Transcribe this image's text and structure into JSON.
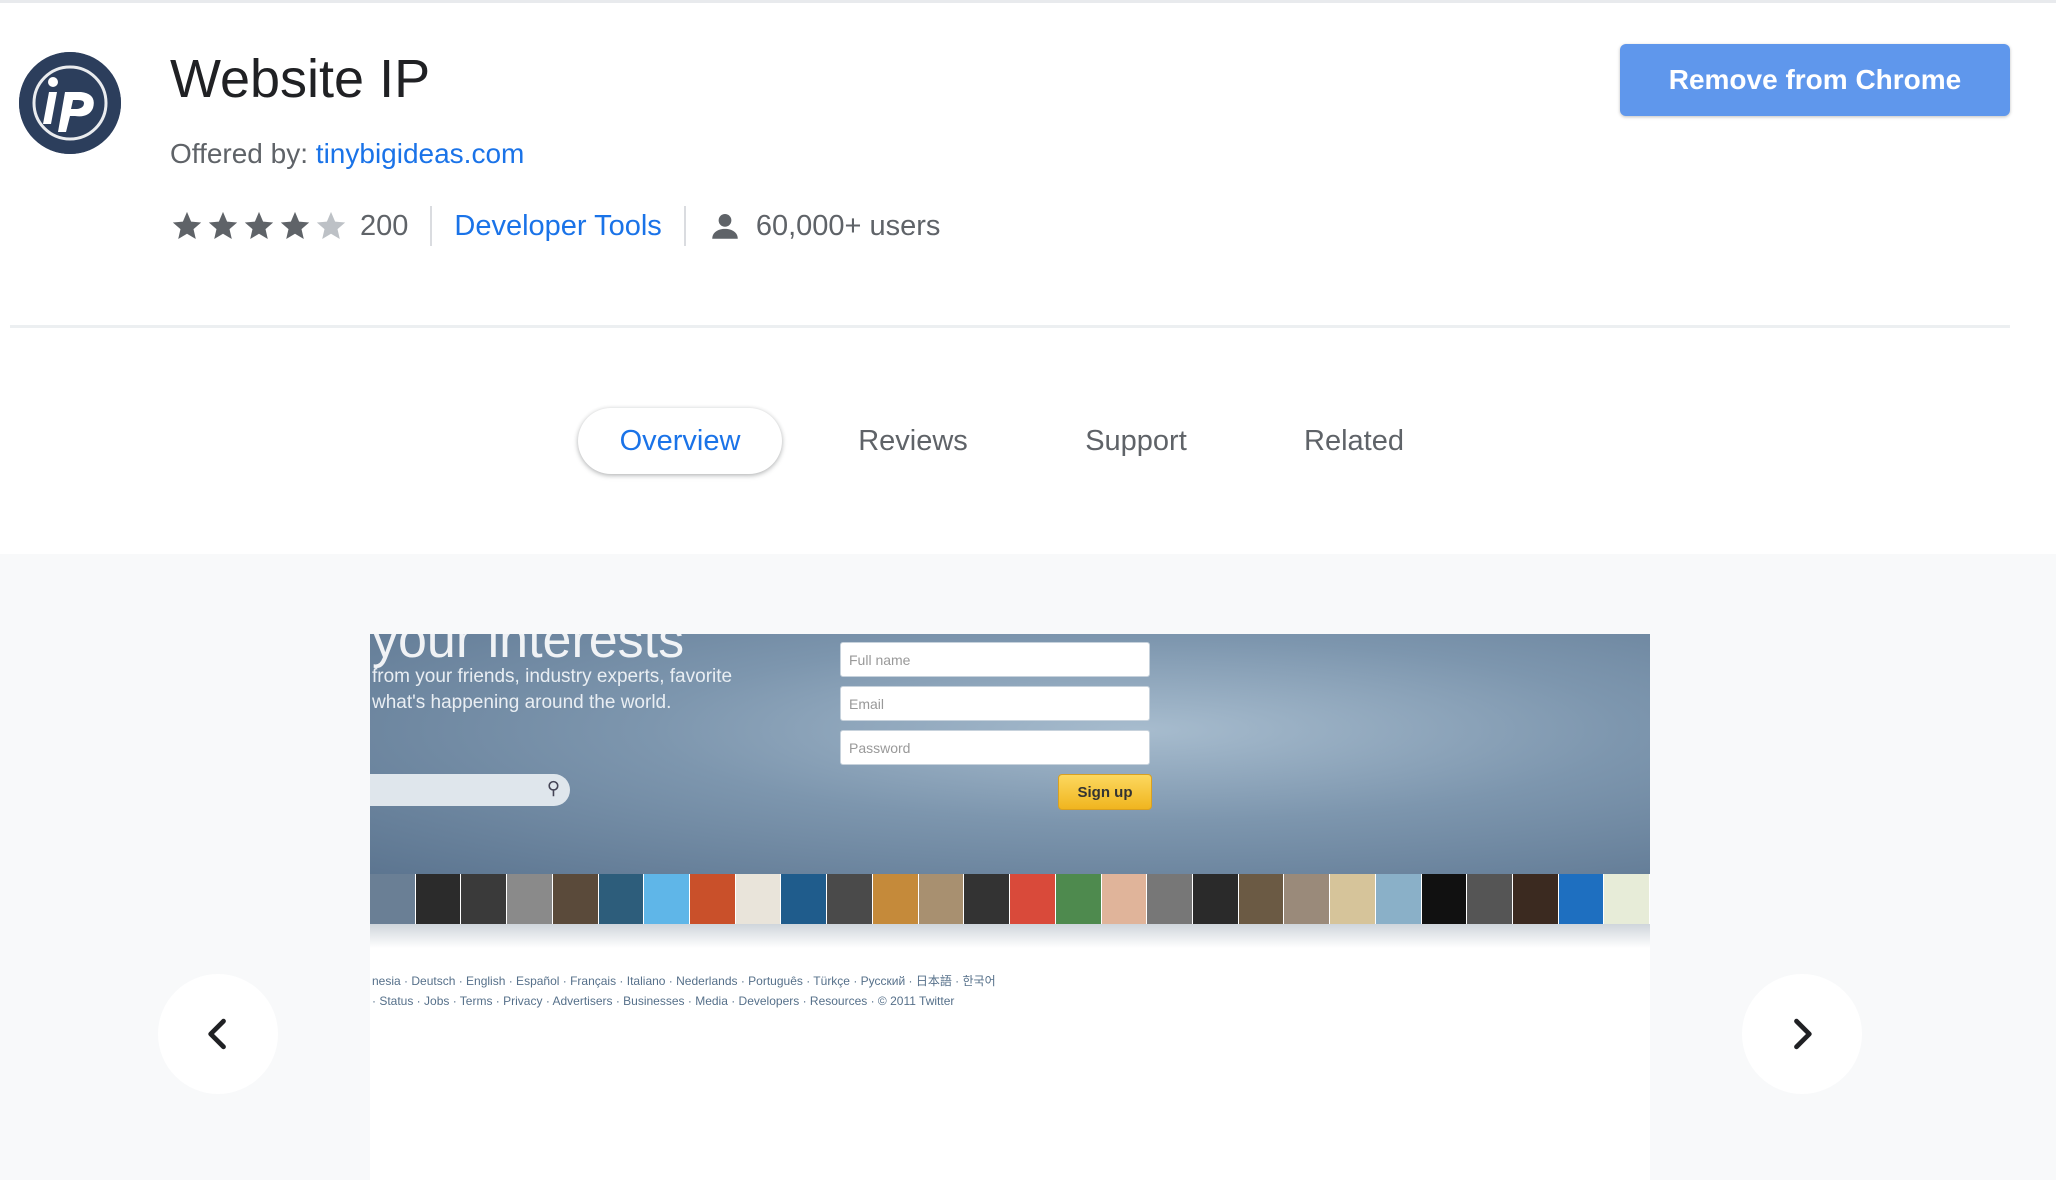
{
  "extension": {
    "name": "Website IP",
    "offered_by_label": "Offered by:",
    "offered_by_link": "tinybigideas.com",
    "rating_stars": 4,
    "rating_max": 5,
    "rating_count": "200",
    "category": "Developer Tools",
    "users": "60,000+ users",
    "logo_icon": "ip-logo-icon"
  },
  "actions": {
    "remove_label": "Remove from Chrome"
  },
  "colors": {
    "accent": "#1a73e8",
    "button": "#5f97ec",
    "logo": "#2c3e5c"
  },
  "tabs": [
    {
      "label": "Overview",
      "active": true
    },
    {
      "label": "Reviews",
      "active": false
    },
    {
      "label": "Support",
      "active": false
    },
    {
      "label": "Related",
      "active": false
    }
  ],
  "screenshot": {
    "heading": "your interests",
    "sub_line_1": "from your friends, industry experts, favorite",
    "sub_line_2": "what's happening around the world.",
    "field_full_name": "Full name",
    "field_email": "Email",
    "field_password": "Password",
    "signup_label": "Sign up",
    "footer_langs": "nesia · Deutsch · English · Español · Français · Italiano · Nederlands · Português · Türkçe · Русский · 日本語 · 한국어",
    "footer_links": "· Status · Jobs · Terms · Privacy · Advertisers · Businesses · Media · Developers · Resources · © 2011 Twitter"
  },
  "carousel": {
    "prev_icon": "chevron-left-icon",
    "next_icon": "chevron-right-icon"
  }
}
